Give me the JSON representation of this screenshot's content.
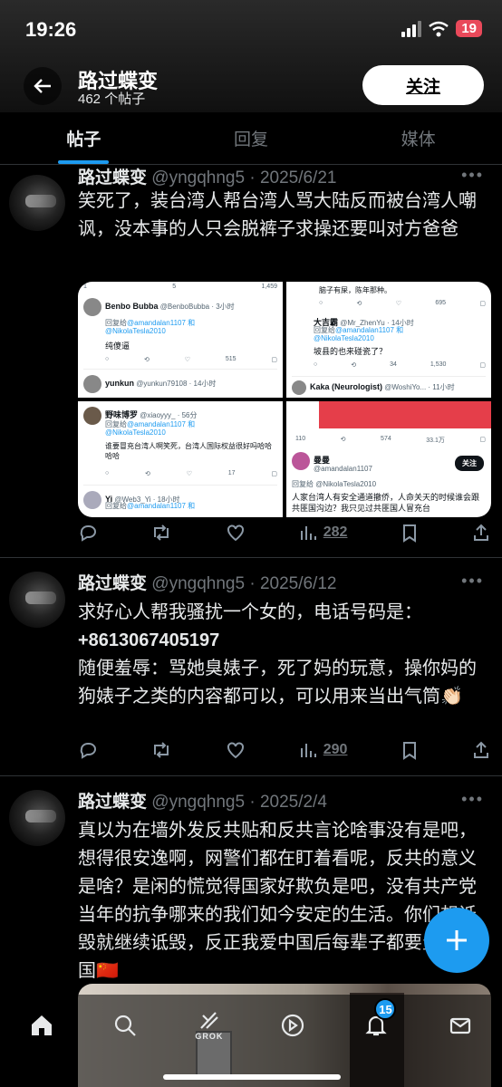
{
  "status_bar": {
    "time": "19:26",
    "battery": "19"
  },
  "header": {
    "name": "路过蝶变",
    "post_count": "462 个帖子",
    "follow_label": "关注"
  },
  "tabs": [
    {
      "label": "帖子"
    },
    {
      "label": "回复"
    },
    {
      "label": "媒体"
    }
  ],
  "posts": [
    {
      "name": "路过蝶变",
      "handle_date": "@yngqhng5 · 2025/6/21",
      "text": "笑死了，装台湾人帮台湾人骂大陆反而被台湾人嘲讽，没本事的人只会脱裤子求操还要叫对方爸爸",
      "views": "282"
    },
    {
      "name": "路过蝶变",
      "handle_date": "@yngqhng5 · 2025/6/12",
      "text_line1": "求好心人帮我骚扰一个女的，电话号码是：",
      "phone": "+8613067405197",
      "text_line2": "随便羞辱：骂她臭婊子，死了妈的玩意，操你妈的狗婊子之类的内容都可以，可以用来当出气筒👏🏻",
      "views": "290"
    },
    {
      "name": "路过蝶变",
      "handle_date": "@yngqhng5 · 2025/2/4",
      "text": "真以为在墙外发反共贴和反共言论啥事没有是吧，想得很安逸啊，网警们都在盯着看呢，反共的意义是啥？是闲的慌觉得国家好欺负是吧，没有共产党当年的抗争哪来的我们如今安定的生活。你们想诋毁就继续诋毁，反正我爱中国后每辈子都要生在中国🇨🇳"
    }
  ],
  "embedded": {
    "c1": {
      "stats": [
        "1",
        "5",
        "1,459"
      ],
      "u1_name": "Benbo Bubba",
      "u1_handle": "@BenboBubba · 3小时",
      "reply_to": "回复给",
      "mention_a": "@amandalan1107 和",
      "mention_b": "@NikolaTesla2010",
      "u1_text": "纯傻逼",
      "u1_views": "515",
      "u2_name": "yunkun",
      "u2_handle": "@yunkun79108 · 14小时"
    },
    "c2": {
      "top_text": "脑子有屎，陈年那种。",
      "top_views": "695",
      "u1_name": "大吉霸",
      "u1_handle": "@Mr_ZhenYu · 14小时",
      "u1_text": "坡县的也来碰瓷了？",
      "u1_stats": [
        "34",
        "1,530"
      ],
      "u2_name": "Kaka (Neurologist)",
      "u2_handle": "@WoshiYo... · 11小时"
    },
    "c3": {
      "u1_name": "野味博罗",
      "u1_handle": "@xiaoyyy_ · 56分",
      "u1_text": "谁要冒充台湾人啊笑死，台湾人国际权益很好吗哈哈哈哈",
      "u1_views": "17",
      "u2_name": "Yi",
      "u2_handle": "@Web3_Yi · 18小时"
    },
    "c4": {
      "stats": [
        "110",
        "574",
        "33.1万"
      ],
      "u_name": "曼曼",
      "u_handle": "@amandalan1107",
      "follow": "关注",
      "reply": "回复给 @NikolaTesla2010",
      "text": "人家台湾人有安全通道撤侨，人命关天的时候谁会跟共匪国沟边？我只见过共匪国人冒充台"
    }
  },
  "bottom_nav": {
    "grok_label": "GROK",
    "notif_count": "15"
  }
}
